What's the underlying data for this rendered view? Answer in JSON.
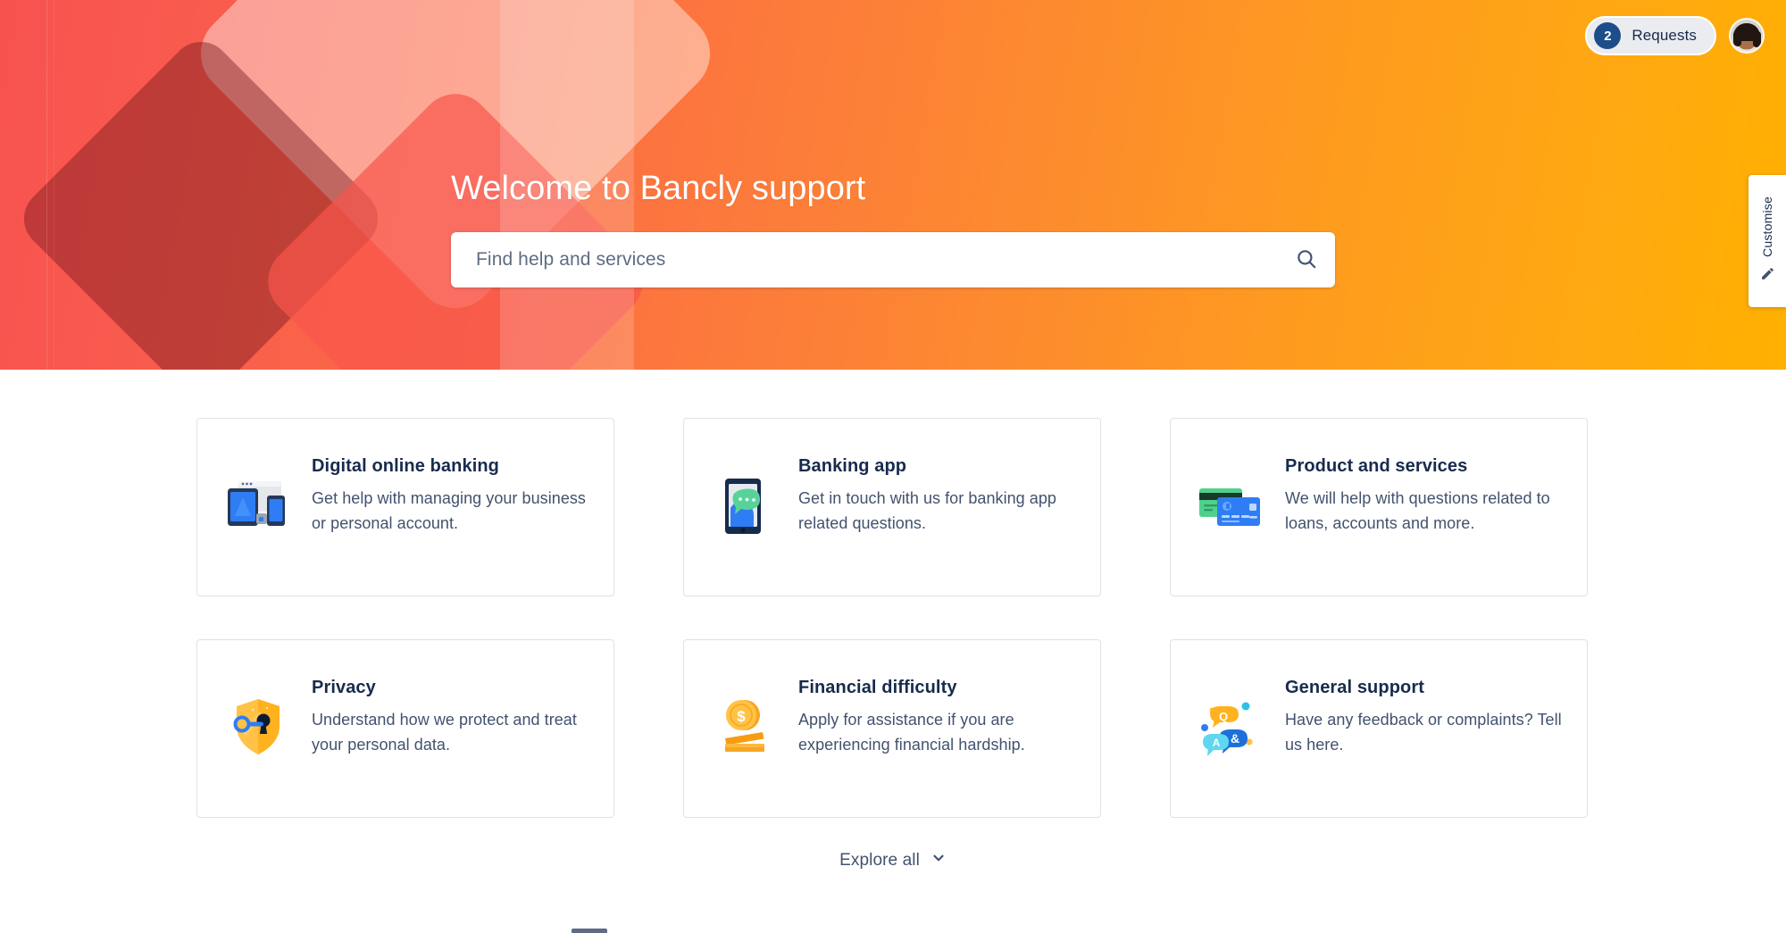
{
  "topbar": {
    "requests_count": "2",
    "requests_label": "Requests",
    "avatar_name": "user-avatar"
  },
  "customise": {
    "label": "Customise",
    "icon": "pencil-icon"
  },
  "hero": {
    "title": "Welcome to Bancly support",
    "search_placeholder": "Find help and services",
    "search_value": "",
    "search_icon": "search-icon",
    "gradient_start": "#f8524f",
    "gradient_end": "#ffb000"
  },
  "cards": [
    {
      "title": "Digital online banking",
      "desc": "Get help with managing your business or personal account.",
      "icon": "devices-icon"
    },
    {
      "title": "Banking app",
      "desc": "Get in touch with us for banking app related questions.",
      "icon": "mobile-chat-icon"
    },
    {
      "title": "Product and services",
      "desc": "We will help with questions related to loans, accounts and more.",
      "icon": "credit-cards-icon"
    },
    {
      "title": "Privacy",
      "desc": "Understand how we protect and treat your personal data.",
      "icon": "shield-key-icon"
    },
    {
      "title": "Financial difficulty",
      "desc": "Apply for assistance if you are experiencing financial hardship.",
      "icon": "coins-icon"
    },
    {
      "title": "General support",
      "desc": "Have any feedback or complaints? Tell us here.",
      "icon": "qa-bubbles-icon"
    }
  ],
  "explore": {
    "label": "Explore all",
    "icon": "chevron-down-icon"
  }
}
